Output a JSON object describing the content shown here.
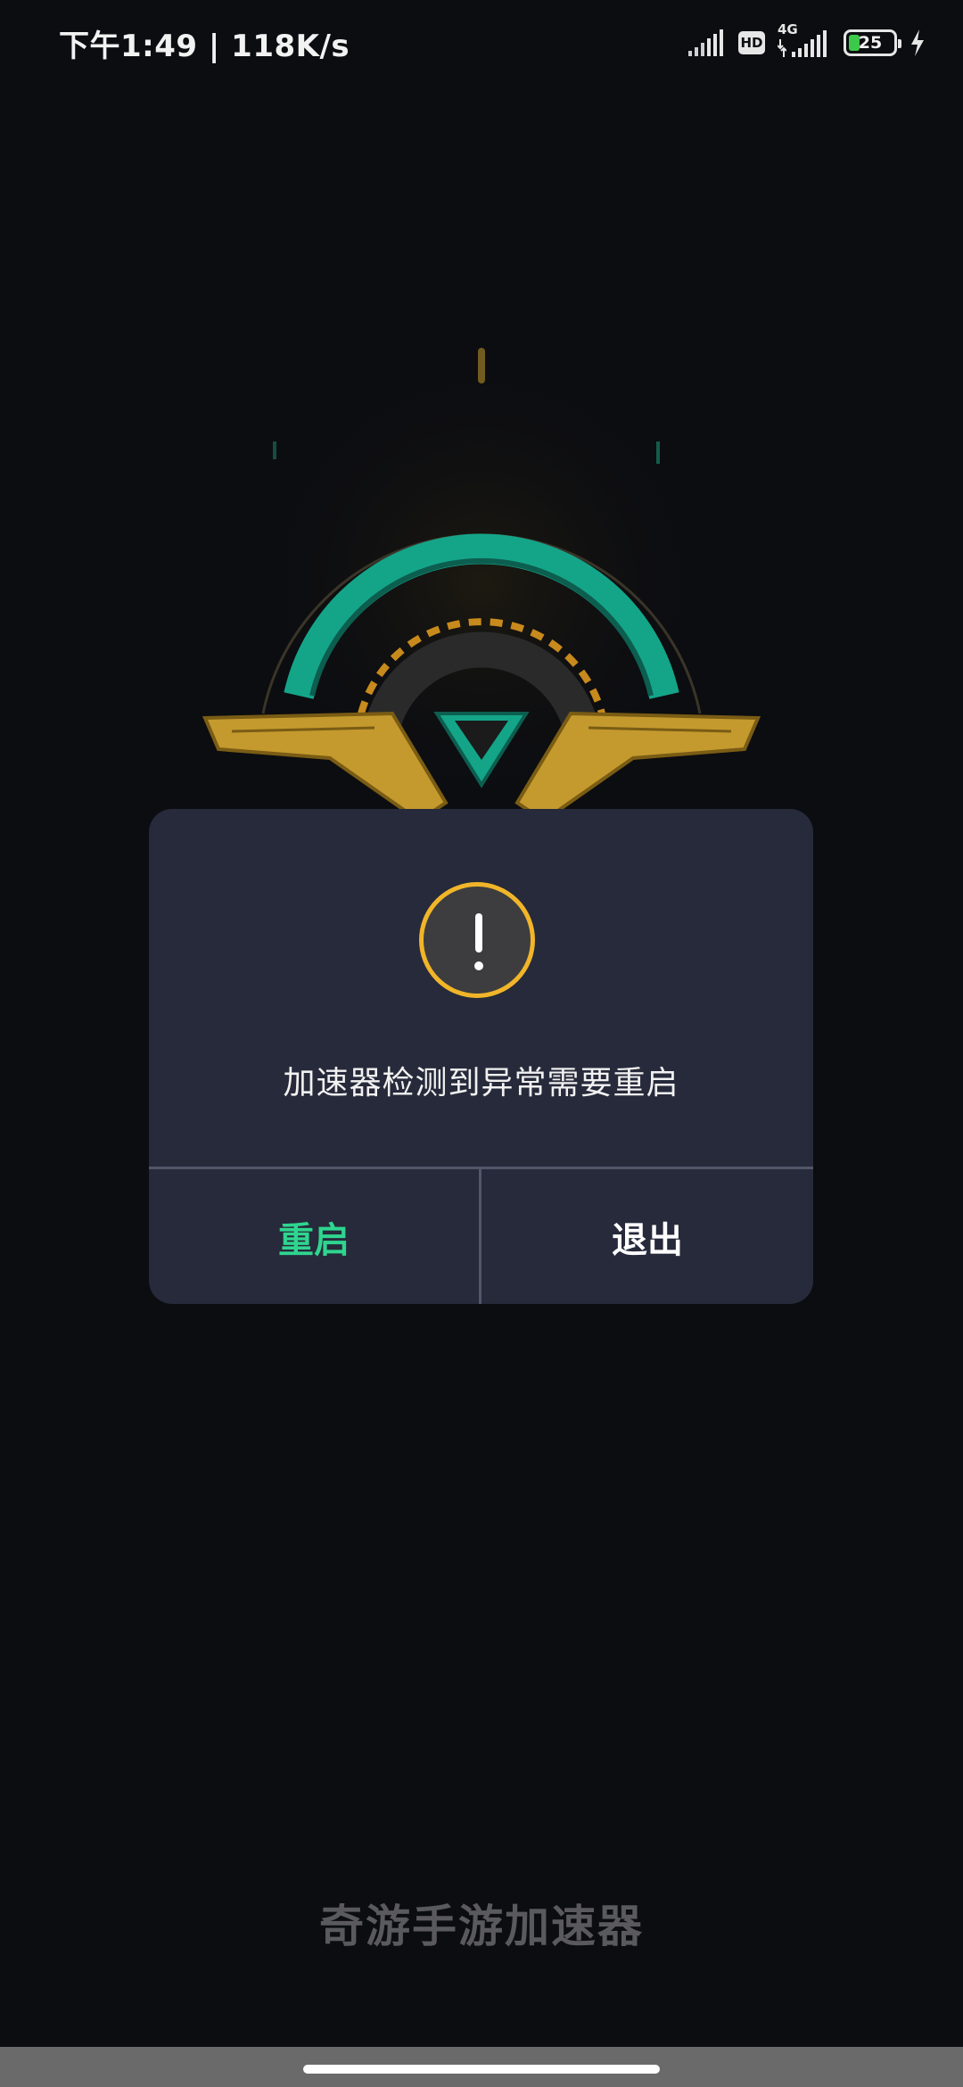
{
  "status_bar": {
    "time": "下午1:49 | 118K/s",
    "hd_label": "HD",
    "network_label": "4G",
    "battery_level": "25",
    "icons": [
      "signal-icon",
      "hd-icon",
      "signal-4g-icon",
      "battery-icon",
      "charging-icon"
    ]
  },
  "dialog": {
    "icon": "warning-icon",
    "message": "加速器检测到异常需要重启",
    "restart_label": "重启",
    "exit_label": "退出",
    "colors": {
      "background": "#262a3a",
      "icon_ring": "#f1b529",
      "restart_text": "#2fd58f"
    }
  },
  "app": {
    "name": "奇游手游加速器"
  }
}
